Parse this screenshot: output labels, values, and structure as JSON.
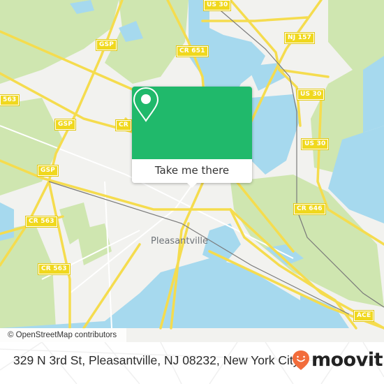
{
  "map": {
    "road_shields": [
      {
        "label": "US 30"
      },
      {
        "label": "NJ 157"
      },
      {
        "label": "US 30"
      },
      {
        "label": "US 30"
      },
      {
        "label": "GSP"
      },
      {
        "label": "CR 651"
      },
      {
        "label": "563"
      },
      {
        "label": "GSP"
      },
      {
        "label": "CR"
      },
      {
        "label": "CR"
      },
      {
        "label": "GSP"
      },
      {
        "label": "CR 563"
      },
      {
        "label": "CR 563"
      },
      {
        "label": "CR 646"
      },
      {
        "label": "ACE"
      }
    ],
    "place_label": "Pleasantville",
    "attribution": "© OpenStreetMap contributors",
    "colors": {
      "land": "#f2f2ef",
      "water": "#a6d9ee",
      "park": "#cfe6b0",
      "road": "#f5dc4e",
      "shield": "#f0d81e"
    }
  },
  "popup": {
    "icon": "location-pin-icon",
    "button_label": "Take me there",
    "color": "#20b96b"
  },
  "footer": {
    "address": "329 N 3rd St, Pleasantville, NJ 08232, New York City",
    "logo_text": "moovit",
    "logo_icon": "moovit-smile-pin-icon",
    "logo_color": "#f26c3b"
  }
}
